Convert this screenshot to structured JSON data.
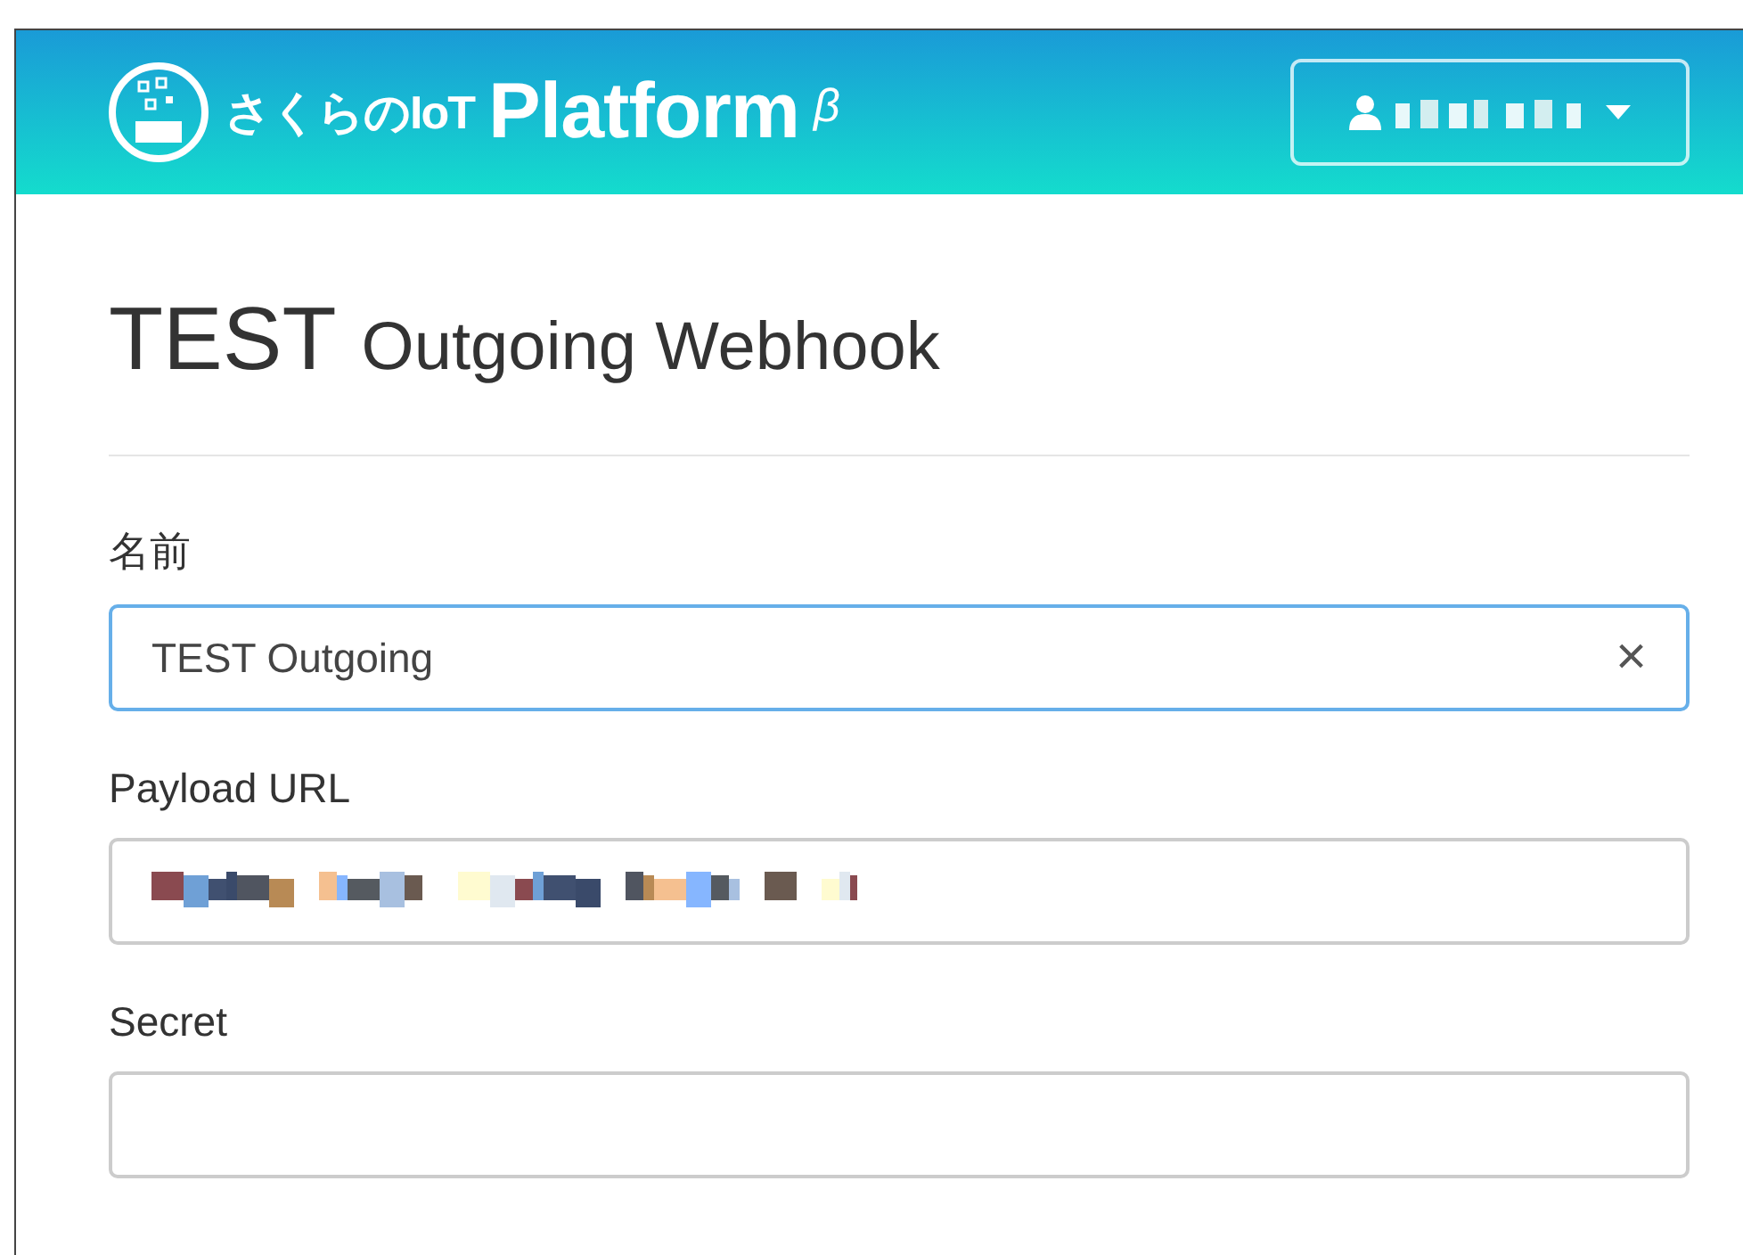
{
  "header": {
    "brand": "さくらのIoT",
    "product": "Platform",
    "badge": "β",
    "user_menu": {
      "kind": "obscured"
    }
  },
  "title": {
    "main": "TEST",
    "sub": "Outgoing Webhook"
  },
  "fields": [
    {
      "label": "名前",
      "kind": "text",
      "value": "TEST Outgoing",
      "focused": true,
      "clear": "×"
    },
    {
      "label": "Payload URL",
      "kind": "obscured",
      "focused": false
    },
    {
      "label": "Secret",
      "kind": "text",
      "focused": false
    }
  ]
}
